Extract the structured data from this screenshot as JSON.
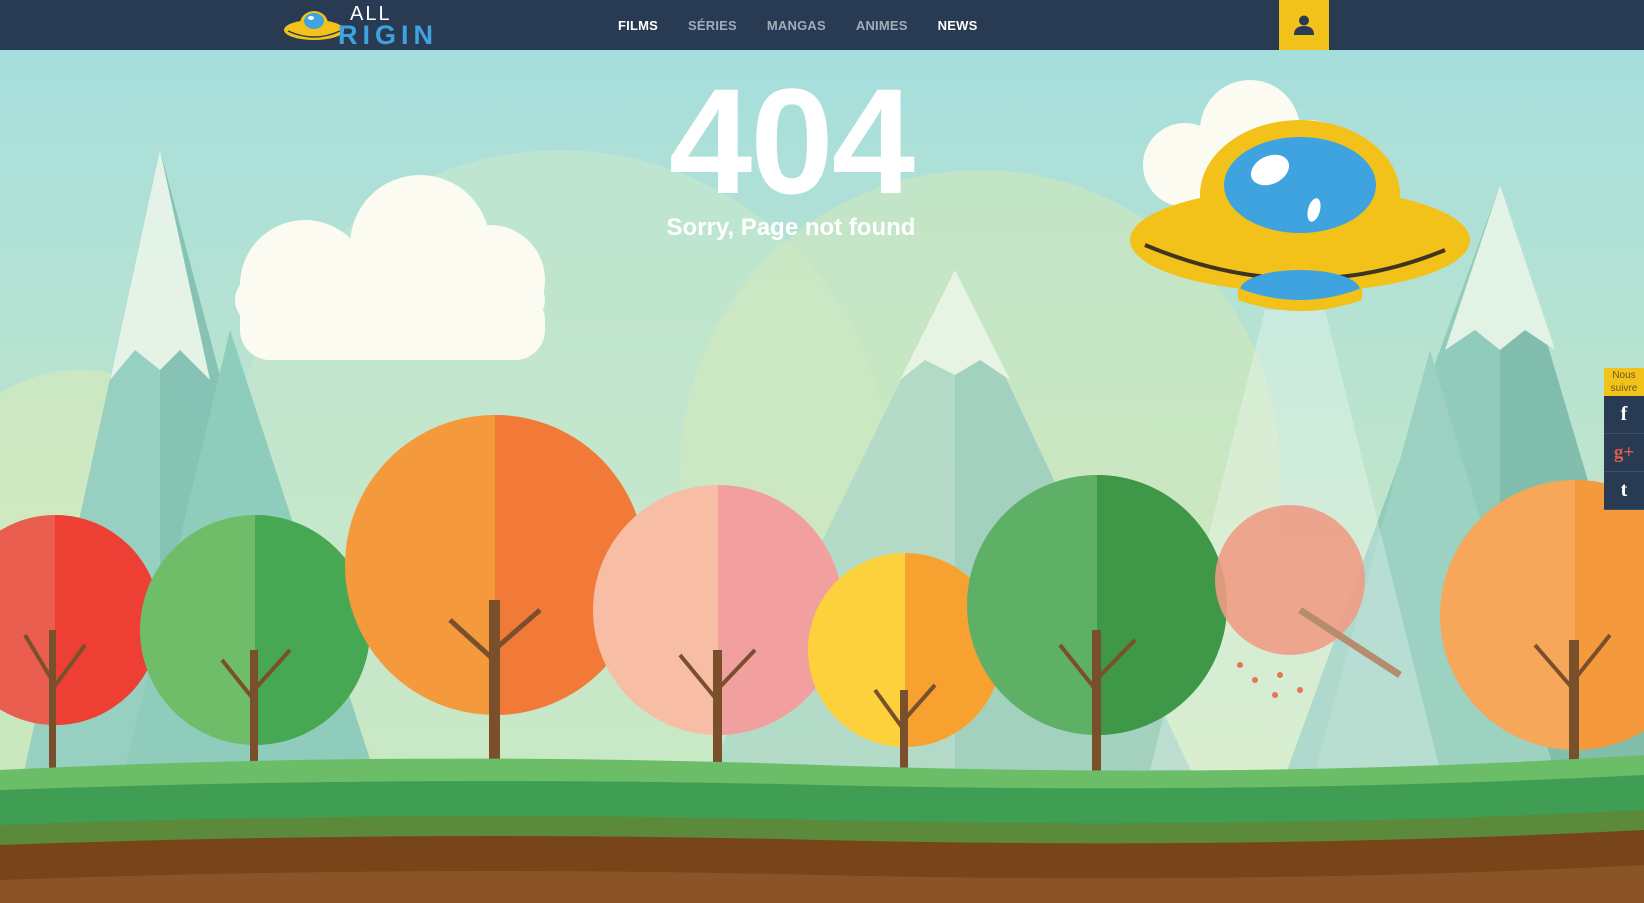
{
  "header": {
    "logo_top": "ALL",
    "logo_bottom": "RIGIN",
    "nav": [
      {
        "label": "FILMS",
        "active": true
      },
      {
        "label": "SÉRIES",
        "active": false
      },
      {
        "label": "MANGAS",
        "active": false
      },
      {
        "label": "ANIMES",
        "active": false
      },
      {
        "label": "NEWS",
        "active": true
      }
    ],
    "user_icon": "user-icon"
  },
  "error": {
    "code": "404",
    "message": "Sorry, Page not found"
  },
  "social": {
    "label": "Nous suivre",
    "buttons": [
      {
        "name": "facebook",
        "glyph": "f"
      },
      {
        "name": "google-plus",
        "glyph": "g+"
      },
      {
        "name": "tumblr",
        "glyph": "t"
      }
    ]
  },
  "colors": {
    "header_bg": "#283b53",
    "accent_yellow": "#f2c21a",
    "logo_blue": "#3ea3df",
    "sky": "#a9dfdd"
  }
}
